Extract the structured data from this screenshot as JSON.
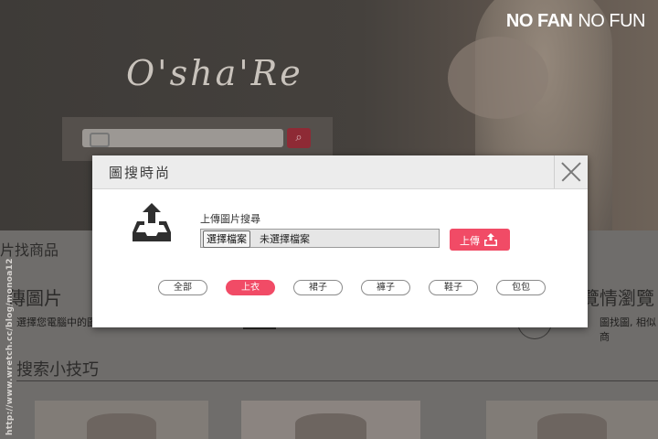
{
  "header": {
    "logo_text": "O'sha'Re",
    "brand_bold": "NO FAN",
    "brand_light": "NO FUN"
  },
  "background": {
    "find_products": "片找商品",
    "upload_photo": "傳圖片",
    "upload_desc": "選擇您電腦中的圖",
    "browse_title": "覽情瀏覽",
    "browse_desc": "圖找圖, 相似商",
    "tips_title": "搜索小技巧",
    "watermark": "http://www.wretch.cc/blog/monoa12"
  },
  "modal": {
    "title": "圖搜時尚",
    "upload_label": "上傳圖片搜尋",
    "file_button": "選擇檔案",
    "file_status": "未選擇檔案",
    "upload_button": "上傳",
    "categories": [
      {
        "label": "全部",
        "active": false
      },
      {
        "label": "上衣",
        "active": true
      },
      {
        "label": "裙子",
        "active": false
      },
      {
        "label": "褲子",
        "active": false
      },
      {
        "label": "鞋子",
        "active": false
      },
      {
        "label": "包包",
        "active": false
      }
    ]
  },
  "colors": {
    "accent": "#f14b66",
    "overlay_bg": "#4a4643",
    "modal_header": "#ececec"
  },
  "icons": {
    "upload": "tray-upload-icon",
    "close": "close-icon",
    "camera": "camera-icon",
    "search": "search-icon",
    "upload_button": "upload-icon"
  }
}
